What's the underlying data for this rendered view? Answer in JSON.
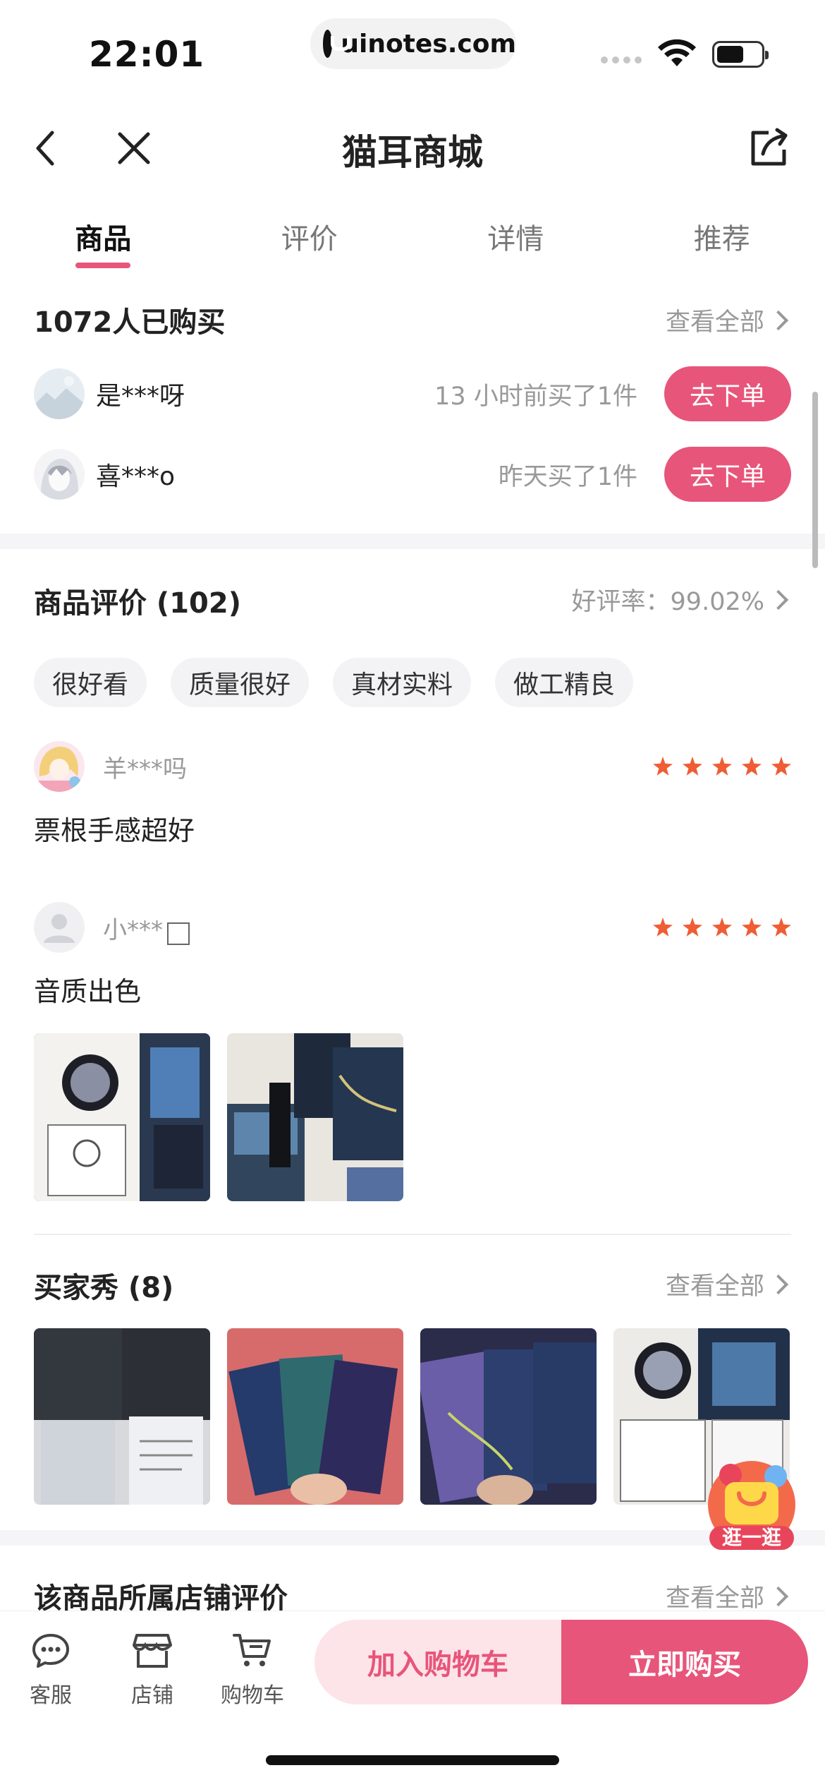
{
  "status_bar": {
    "time": "22:01",
    "url": "uinotes.com"
  },
  "nav": {
    "title": "猫耳商城"
  },
  "tabs": [
    {
      "label": "商品",
      "active": true
    },
    {
      "label": "评价",
      "active": false
    },
    {
      "label": "详情",
      "active": false
    },
    {
      "label": "推荐",
      "active": false
    }
  ],
  "buyers": {
    "title": "1072人已购买",
    "view_all": "查看全部",
    "items": [
      {
        "name": "是***呀",
        "time": "13 小时前买了1件",
        "button": "去下单"
      },
      {
        "name": "喜***o",
        "time": "昨天买了1件",
        "button": "去下单"
      }
    ]
  },
  "reviews": {
    "title": "商品评价 (102)",
    "rating": "好评率：99.02%",
    "tags": [
      "很好看",
      "质量很好",
      "真材实料",
      "做工精良"
    ],
    "items": [
      {
        "name": "羊***吗",
        "stars": 5,
        "text": "票根手感超好"
      },
      {
        "name": "小***",
        "stars": 5,
        "text": "音质出色"
      }
    ]
  },
  "buyer_show": {
    "title": "买家秀 (8)",
    "view_all": "查看全部"
  },
  "store_reviews": {
    "title": "该商品所属店铺评价",
    "view_all": "查看全部"
  },
  "floating": {
    "label": "逛一逛"
  },
  "bottom_bar": {
    "service": "客服",
    "store": "店铺",
    "cart": "购物车",
    "add_to_cart": "加入购物车",
    "buy_now": "立即购买"
  },
  "colors": {
    "accent": "#e8557a",
    "star": "#ef5d35",
    "muted": "#999999"
  }
}
